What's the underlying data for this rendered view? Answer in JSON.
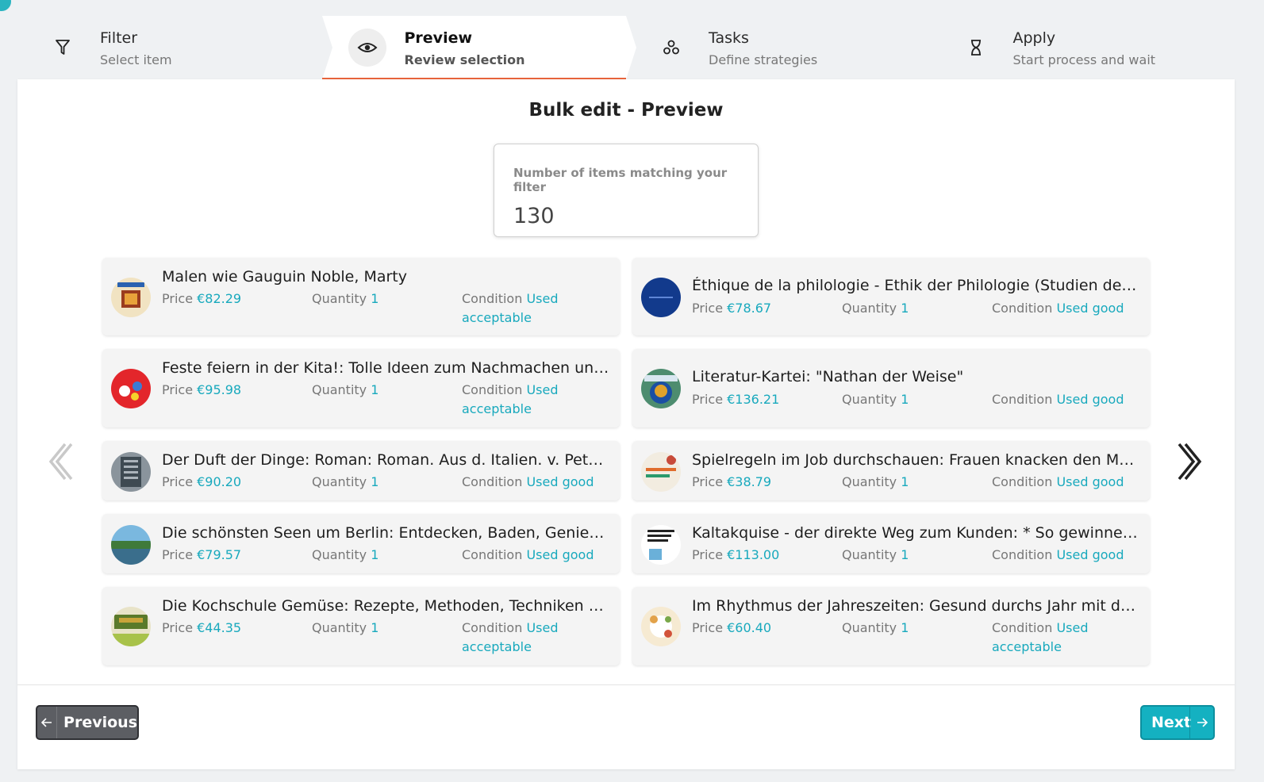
{
  "steps": [
    {
      "title": "Filter",
      "subtitle": "Select item",
      "icon": "filter-icon",
      "active": false
    },
    {
      "title": "Preview",
      "subtitle": "Review selection",
      "icon": "eye-icon",
      "active": true
    },
    {
      "title": "Tasks",
      "subtitle": "Define strategies",
      "icon": "tasks-icon",
      "active": false
    },
    {
      "title": "Apply",
      "subtitle": "Start process and wait",
      "icon": "hourglass-icon",
      "active": false
    }
  ],
  "page_title": "Bulk edit - Preview",
  "count_box": {
    "label": "Number of items matching your filter",
    "value": "130"
  },
  "labels": {
    "price": "Price",
    "quantity": "Quantity",
    "condition": "Condition"
  },
  "items": [
    {
      "title": "Malen wie Gauguin Noble, Marty",
      "price": "€82.29",
      "quantity": "1",
      "condition": "Used acceptable"
    },
    {
      "title": "Éthique de la philologie - Ethik der Philologie (Studien des Fra...",
      "price": "€78.67",
      "quantity": "1",
      "condition": "Used good"
    },
    {
      "title": "Feste feiern in der Kita!: Tolle Ideen zum Nachmachen und Mitf...",
      "price": "€95.98",
      "quantity": "1",
      "condition": "Used acceptable"
    },
    {
      "title": "Literatur-Kartei: \"Nathan der Weise\"",
      "price": "€136.21",
      "quantity": "1",
      "condition": "Used good"
    },
    {
      "title": "Der Duft der Dinge: Roman: Roman. Aus d. Italien. v. Peter Klöss...",
      "price": "€90.20",
      "quantity": "1",
      "condition": "Used good"
    },
    {
      "title": "Spielregeln im Job durchschauen: Frauen knacken den Männer-...",
      "price": "€38.79",
      "quantity": "1",
      "condition": "Used good"
    },
    {
      "title": "Die schönsten Seen um Berlin: Entdecken, Baden, Geniessen Ta...",
      "price": "€79.57",
      "quantity": "1",
      "condition": "Used good"
    },
    {
      "title": "Kaltakquise - der direkte Weg zum Kunden: * So gewinnen Sie ...",
      "price": "€113.00",
      "quantity": "1",
      "condition": "Used good"
    },
    {
      "title": "Die Kochschule Gemüse: Rezepte, Methoden, Techniken Madiso...",
      "price": "€44.35",
      "quantity": "1",
      "condition": "Used acceptable"
    },
    {
      "title": "Im Rhythmus der Jahreszeiten: Gesund durchs Jahr mit dem tra...",
      "price": "€60.40",
      "quantity": "1",
      "condition": "Used acceptable"
    }
  ],
  "buttons": {
    "previous": "Previous",
    "next": "Next"
  },
  "colors": {
    "accent": "#18a9bd",
    "active_step_underline": "#e8643c",
    "next_button": "#14b1c1",
    "previous_button": "#5c5e63"
  }
}
